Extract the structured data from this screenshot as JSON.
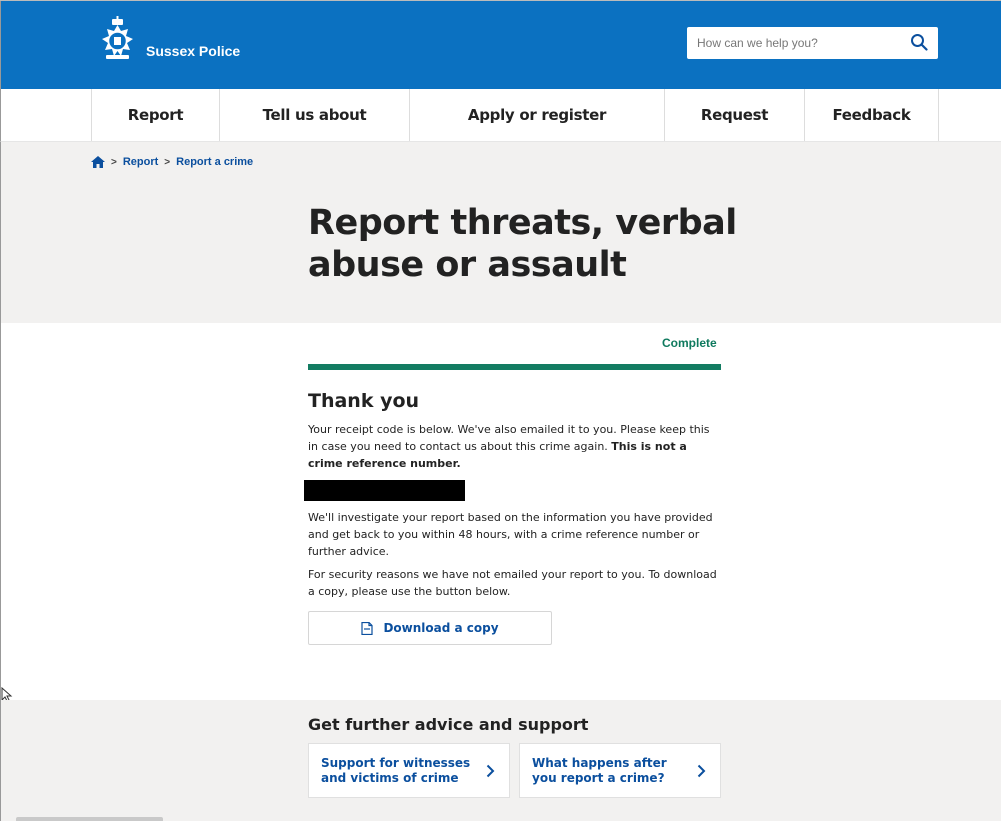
{
  "header": {
    "brand": "Sussex Police",
    "search_placeholder": "How can we help you?"
  },
  "nav": {
    "items": [
      {
        "label": "Report"
      },
      {
        "label": "Tell us about"
      },
      {
        "label": "Apply or register"
      },
      {
        "label": "Request"
      },
      {
        "label": "Feedback"
      }
    ]
  },
  "breadcrumb": {
    "items": [
      "Report",
      "Report a crime"
    ],
    "separator": ">"
  },
  "page": {
    "title": "Report threats, verbal abuse or assault",
    "progress_label": "Complete",
    "progress_fraction": 1.0,
    "heading": "Thank you",
    "para1_text": "Your receipt code is below. We've also emailed it to you. Please keep this in case you need to contact us about this crime again. ",
    "para1_bold": "This is not a crime reference number.",
    "para2": "We'll investigate your report based on the information you have provided and get back to you within 48 hours, with a crime reference number or further advice.",
    "para3": "For security reasons we have not emailed your report to you. To download a copy, please use the button below.",
    "download_label": "Download a copy"
  },
  "advice": {
    "heading": "Get further advice and support",
    "cards": [
      {
        "label": "Support for witnesses and victims of crime"
      },
      {
        "label": "What happens after you report a crime?"
      }
    ]
  },
  "colors": {
    "header_blue": "#0b71c1",
    "link_blue": "#0b4f9e",
    "progress_green": "#137c62",
    "hero_grey": "#f2f1f0"
  },
  "icons": [
    "crest-logo",
    "search-icon",
    "home-icon",
    "document-icon",
    "chevron-right-icon",
    "cursor-icon"
  ]
}
